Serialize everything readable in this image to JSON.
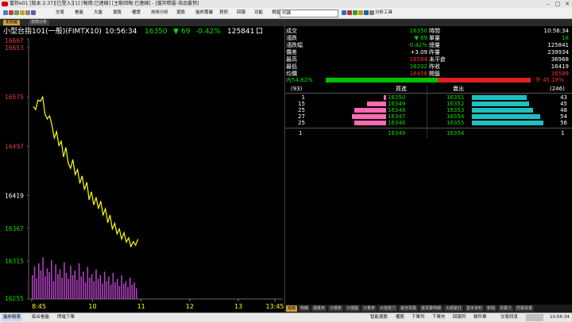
{
  "window": {
    "title": "富邦e01 [版本 2.37][已登入][1] [報價:已連線] [主動回報:已連線] - [盤邦精靈-商品盤勢]",
    "min": "–",
    "max": "□",
    "close": "✕"
  },
  "menu": {
    "items": [
      "交易",
      "看盤",
      "大盤",
      "選股",
      "權證",
      "技術分析",
      "選股",
      "盤邦專屬",
      "資訊",
      "回報",
      "功能",
      "視窗"
    ],
    "combo_value": "代碼",
    "analysis_tools": "分析工具"
  },
  "tabs": [
    "走勢圖",
    "技術分析"
  ],
  "chart": {
    "symbol": "小型台指101(一般)(FIMTX10)",
    "time": "10:56:34",
    "price": "16350",
    "arrow": "▼",
    "change": "69",
    "pct": "-0.42%",
    "volume": "125841",
    "y_ticks": [
      "16667",
      "16653",
      "16575",
      "16497",
      "16419",
      "16367",
      "16315",
      "16255"
    ],
    "x_ticks": [
      "8:45",
      "10",
      "11",
      "12",
      "13",
      "13:45"
    ]
  },
  "chart_data": {
    "type": "line",
    "x_axis": "time",
    "x_ticks": [
      "8:45",
      "10",
      "11",
      "12",
      "13",
      "13:45"
    ],
    "y_ticks": [
      16667,
      16653,
      16575,
      16497,
      16419,
      16367,
      16315,
      16255
    ],
    "ylim": [
      16255,
      16667
    ],
    "series": [
      {
        "values": [
          16560,
          16555,
          16570,
          16568,
          16575,
          16548,
          16540,
          16545,
          16530,
          16510,
          16520,
          16498,
          16505,
          16480,
          16495,
          16470,
          16462,
          16476,
          16452,
          16460,
          16438,
          16450,
          16428,
          16440,
          16412,
          16425,
          16404,
          16416,
          16398,
          16410,
          16388,
          16398,
          16376,
          16388,
          16366,
          16375,
          16358,
          16366,
          16350,
          16360,
          16345,
          16352,
          16338,
          16346,
          16340,
          16350
        ]
      }
    ],
    "volume_bars": [
      40,
      55,
      35,
      60,
      48,
      70,
      38,
      52,
      45,
      65,
      30,
      58,
      42,
      50,
      36,
      62,
      44,
      34,
      56,
      40,
      48,
      32,
      60,
      38,
      46,
      28,
      54,
      36,
      42,
      30,
      50,
      34,
      40,
      26,
      46,
      30,
      38,
      24,
      44,
      28,
      34,
      22,
      40,
      26,
      30,
      20,
      36,
      24,
      28,
      18
    ],
    "grid": false
  },
  "quote": {
    "rows": [
      {
        "l1": "成交",
        "v1": "16350",
        "l2": "時間",
        "v2": "10:56:34",
        "c1": "#00e000",
        "c2": "#ffffff"
      },
      {
        "l1": "漲跌",
        "v1": "▼ 69",
        "l2": "單量",
        "v2": "18",
        "c1": "#00e000",
        "c2": "#00e000"
      },
      {
        "l1": "漲跌幅",
        "v1": "-0.42%",
        "l2": "總量",
        "v2": "125841",
        "c1": "#00e000",
        "c2": "#ffffff"
      },
      {
        "l1": "價差",
        "v1": "+3.09",
        "l2": "昨量",
        "v2": "239934",
        "c1": "#ffffff",
        "c2": "#ffffff"
      },
      {
        "l1": "最高",
        "v1": "16584",
        "l2": "未平倉",
        "v2": "36968",
        "c1": "#ff3030",
        "c2": "#ffffff"
      },
      {
        "l1": "最低",
        "v1": "16332",
        "l2": "昨收",
        "v2": "16419",
        "c1": "#00e000",
        "c2": "#ffffff"
      },
      {
        "l1": "均價",
        "v1": "16458",
        "l2": "開盤",
        "v2": "16589",
        "c1": "#ff3030",
        "c2": "#ff3030"
      }
    ],
    "inner_label": "內54.82%",
    "outer_label": "外 45.18%",
    "inner_pct": 54.82,
    "outer_pct": 45.18
  },
  "orderbook": {
    "bid_total": "(93)",
    "bid_header": "買進",
    "ask_header": "賣出",
    "ask_total": "(246)",
    "rows": [
      {
        "bq": "1",
        "bp": "16350",
        "ap": "16351",
        "aq": "43",
        "bbar": 2,
        "abar": 43
      },
      {
        "bq": "15",
        "bp": "16349",
        "ap": "16352",
        "aq": "45",
        "bbar": 15,
        "abar": 45
      },
      {
        "bq": "25",
        "bp": "16348",
        "ap": "16353",
        "aq": "48",
        "bbar": 25,
        "abar": 48
      },
      {
        "bq": "27",
        "bp": "16347",
        "ap": "16354",
        "aq": "54",
        "bbar": 27,
        "abar": 54
      },
      {
        "bq": "25",
        "bp": "16346",
        "ap": "16355",
        "aq": "56",
        "bbar": 25,
        "abar": 56
      }
    ],
    "footer": {
      "bq": "1",
      "bp": "16349",
      "ap": "16354",
      "aq": "1"
    }
  },
  "bottom_tabs": [
    "明細",
    "價量表",
    "分價表",
    "分價圖",
    "分量表",
    "大陸壓力",
    "最佳買賣",
    "委買賣明細",
    "大額委託",
    "基本資料",
    "新聞",
    "買賣力",
    "閃電買賣"
  ],
  "bottom_first": "經典",
  "status": {
    "left": [
      "盤邦精靈",
      "綜合看盤",
      "閃電下單"
    ],
    "right": [
      "智能選股",
      "權股",
      "下單列",
      "下單夾",
      "回報列",
      "條件單",
      "交易訊息"
    ],
    "clock": "10:56:34"
  },
  "colors": {
    "up": "#ff3030",
    "down": "#00e000",
    "price_line": "#ffff00",
    "volume": "#b040c0",
    "axis_label": "#e04040",
    "bid_bar": "#ff69b4",
    "ask_bar": "#20c0c0"
  }
}
